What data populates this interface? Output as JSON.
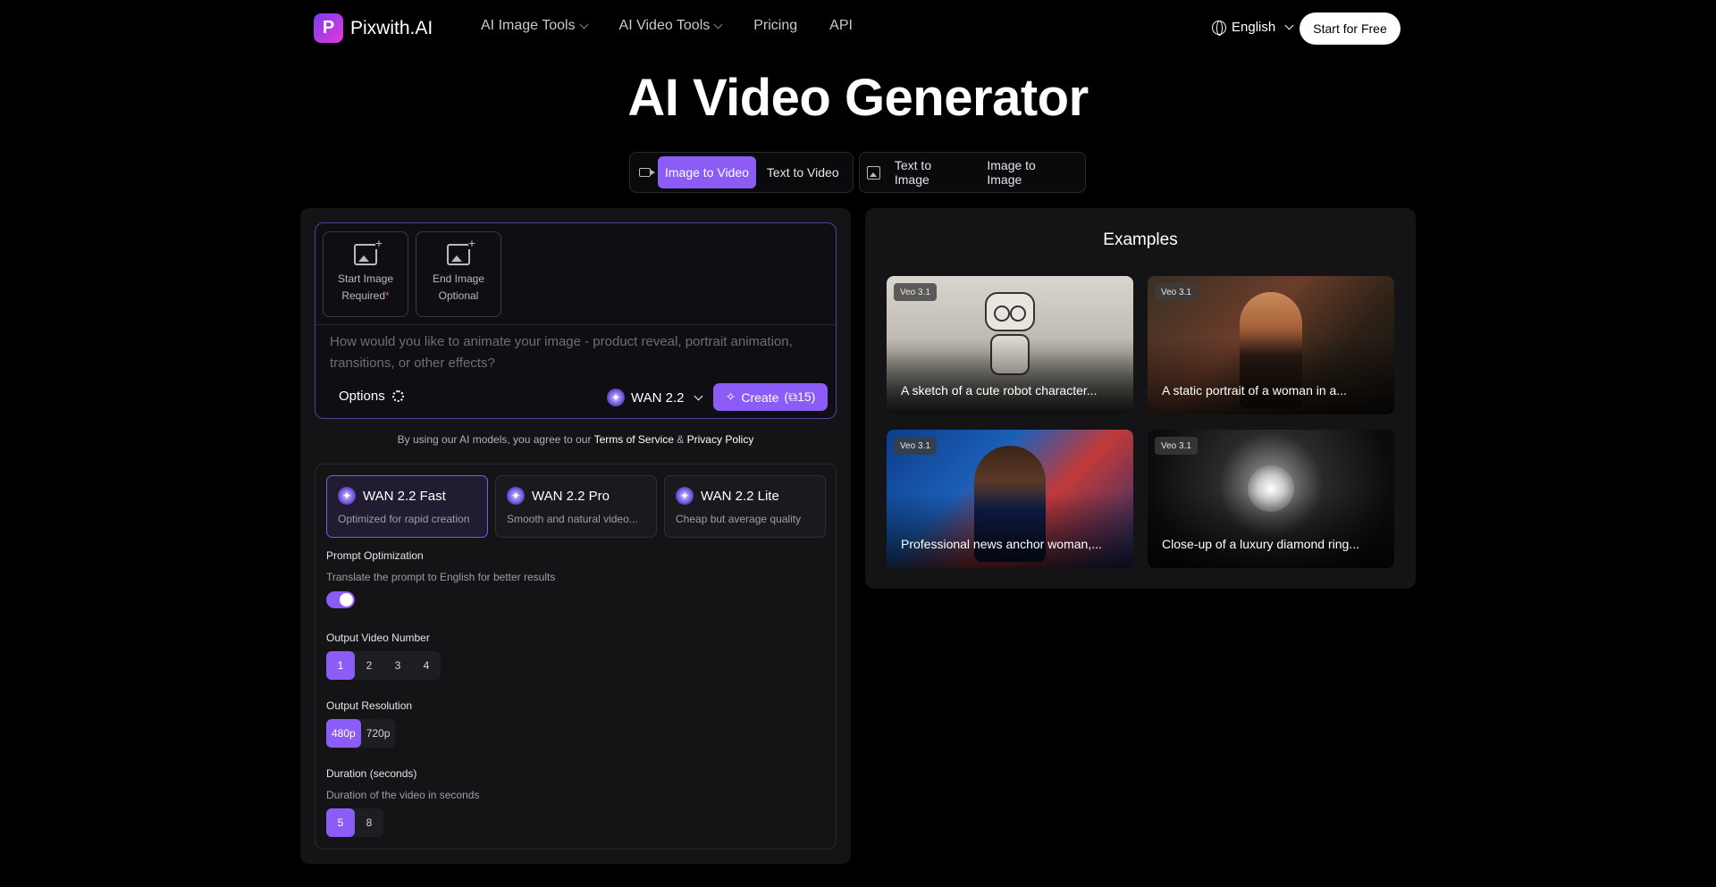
{
  "nav": {
    "logo_letter": "P",
    "logo_text": "Pixwith.AI",
    "menu": [
      {
        "label": "AI Image Tools"
      },
      {
        "label": "AI Video Tools"
      },
      {
        "label": "Pricing"
      },
      {
        "label": "API"
      }
    ],
    "language": "English",
    "cta": "Start for Free"
  },
  "page_title": "AI Video Generator",
  "tabs": {
    "video": [
      "Image to Video",
      "Text to Video"
    ],
    "image": [
      "Text to Image",
      "Image to Image"
    ],
    "active": "Image to Video"
  },
  "prompt": {
    "start_image": {
      "title": "Start Image",
      "sub": "Required",
      "mark": "*"
    },
    "end_image": {
      "title": "End Image",
      "sub": "Optional"
    },
    "placeholder": "How would you like to animate your image - product reveal, portrait animation, transitions, or other effects?",
    "options_label": "Options",
    "model": "WAN 2.2",
    "create_label": "Create",
    "create_cost": "(⧉15)"
  },
  "terms": {
    "prefix": "By using our AI models, you agree to our",
    "tos": "Terms of Service",
    "and": "&",
    "privacy": "Privacy Policy"
  },
  "settings": {
    "models": [
      {
        "name": "WAN 2.2 Fast",
        "desc": "Optimized for rapid creation",
        "active": true
      },
      {
        "name": "WAN 2.2 Pro",
        "desc": "Smooth and natural video...",
        "active": false
      },
      {
        "name": "WAN 2.2 Lite",
        "desc": "Cheap but average quality",
        "active": false
      }
    ],
    "prompt_opt": {
      "label": "Prompt Optimization",
      "desc": "Translate the prompt to English for better results",
      "enabled": true
    },
    "video_number": {
      "label": "Output Video Number",
      "options": [
        "1",
        "2",
        "3",
        "4"
      ],
      "selected": "1"
    },
    "resolution": {
      "label": "Output Resolution",
      "options": [
        "480p",
        "720p"
      ],
      "selected": "480p"
    },
    "duration": {
      "label": "Duration (seconds)",
      "desc": "Duration of the video in seconds",
      "options": [
        "5",
        "8"
      ],
      "selected": "5"
    }
  },
  "examples": {
    "title": "Examples",
    "items": [
      {
        "badge": "Veo 3.1",
        "caption": "A sketch of a cute robot character..."
      },
      {
        "badge": "Veo 3.1",
        "caption": "A static portrait of a woman in a..."
      },
      {
        "badge": "Veo 3.1",
        "caption": "Professional news anchor woman,..."
      },
      {
        "badge": "Veo 3.1",
        "caption": "Close-up of a luxury diamond ring..."
      }
    ]
  },
  "colors": {
    "accent": "#8b5cf6",
    "background": "#000000",
    "panel": "#141416"
  }
}
